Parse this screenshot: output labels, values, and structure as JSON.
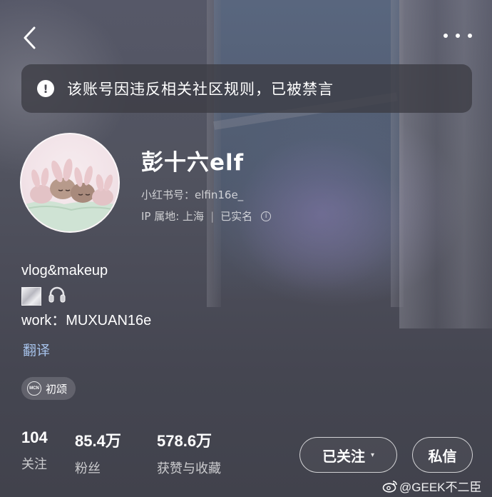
{
  "header": {
    "back_icon": "chevron-left-icon",
    "more_icon": "more-dots-icon"
  },
  "ban_notice": {
    "icon": "alert-circle-icon",
    "text": "该账号因违反相关社区规则，已被禁言"
  },
  "profile": {
    "nickname": "彭十六elf",
    "id_line": "小红书号：elfin16e_",
    "ip_location": "IP 属地: 上海",
    "verification": "已实名",
    "info_icon": "info-circle-icon",
    "avatar": "rabbits-avatar"
  },
  "bio": {
    "line1": "vlog&makeup",
    "emojis": [
      "sparkle-tile-emoji",
      "headphones-emoji"
    ],
    "line2": "work：MUXUAN16e"
  },
  "translate_label": "翻译",
  "tag": {
    "icon": "mcn-icon",
    "icon_text": "MCN",
    "label": "初颂"
  },
  "stats": [
    {
      "value": "104",
      "label": "关注"
    },
    {
      "value": "85.4万",
      "label": "粉丝"
    },
    {
      "value": "578.6万",
      "label": "获赞与收藏"
    }
  ],
  "actions": {
    "follow_label": "已关注",
    "follow_caret": "▾",
    "message_label": "私信"
  },
  "watermark": {
    "icon": "weibo-icon",
    "text": "@GEEK不二臣"
  }
}
